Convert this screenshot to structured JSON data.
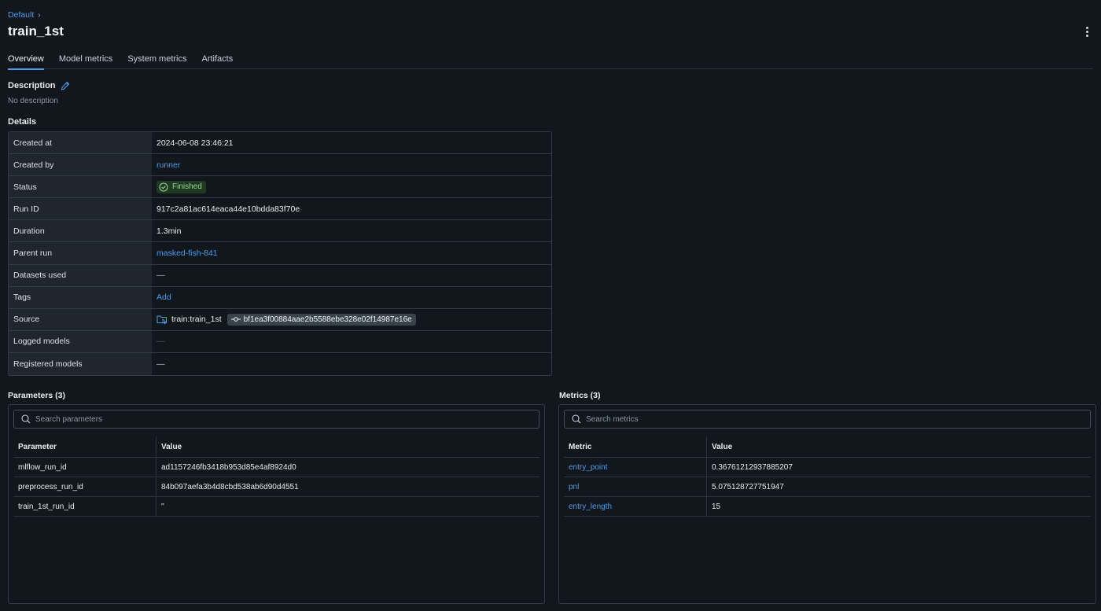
{
  "breadcrumb": {
    "parent": "Default",
    "separator": "›"
  },
  "page": {
    "title": "train_1st"
  },
  "tabs": [
    "Overview",
    "Model metrics",
    "System metrics",
    "Artifacts"
  ],
  "description": {
    "heading": "Description",
    "text": "No description"
  },
  "details": {
    "heading": "Details",
    "created_at": {
      "label": "Created at",
      "value": "2024-06-08 23:46:21"
    },
    "created_by": {
      "label": "Created by",
      "value": "runner"
    },
    "status": {
      "label": "Status",
      "value": "Finished",
      "color": "#9ccf98"
    },
    "run_id": {
      "label": "Run ID",
      "value": "917c2a81ac614eaca44e10bdda83f70e"
    },
    "duration": {
      "label": "Duration",
      "value": "1.3min"
    },
    "parent_run": {
      "label": "Parent run",
      "value": "masked-fish-841"
    },
    "datasets_used": {
      "label": "Datasets used",
      "value": "—"
    },
    "tags": {
      "label": "Tags",
      "value": "Add"
    },
    "source": {
      "label": "Source",
      "entry": "train:train_1st",
      "commit": "bf1ea3f00884aae2b5588ebe328e02f14987e16e"
    },
    "logged_models": {
      "label": "Logged models",
      "value": "—"
    },
    "registered_models": {
      "label": "Registered models",
      "value": "—"
    }
  },
  "parameters": {
    "heading": "Parameters (3)",
    "search_placeholder": "Search parameters",
    "columns": [
      "Parameter",
      "Value"
    ],
    "rows": [
      {
        "key": "mlflow_run_id",
        "value": "ad1157246fb3418b953d85e4af8924d0"
      },
      {
        "key": "preprocess_run_id",
        "value": "84b097aefa3b4d8cbd538ab6d90d4551"
      },
      {
        "key": "train_1st_run_id",
        "value": "''"
      }
    ]
  },
  "metrics": {
    "heading": "Metrics (3)",
    "search_placeholder": "Search metrics",
    "columns": [
      "Metric",
      "Value"
    ],
    "rows": [
      {
        "key": "entry_point",
        "value": "0.36761212937885207"
      },
      {
        "key": "pnl",
        "value": "5.075128727751947"
      },
      {
        "key": "entry_length",
        "value": "15"
      }
    ]
  },
  "colors": {
    "accent": "#4c9ce8",
    "background": "#11171d",
    "success_bg": "#1e3a21"
  }
}
